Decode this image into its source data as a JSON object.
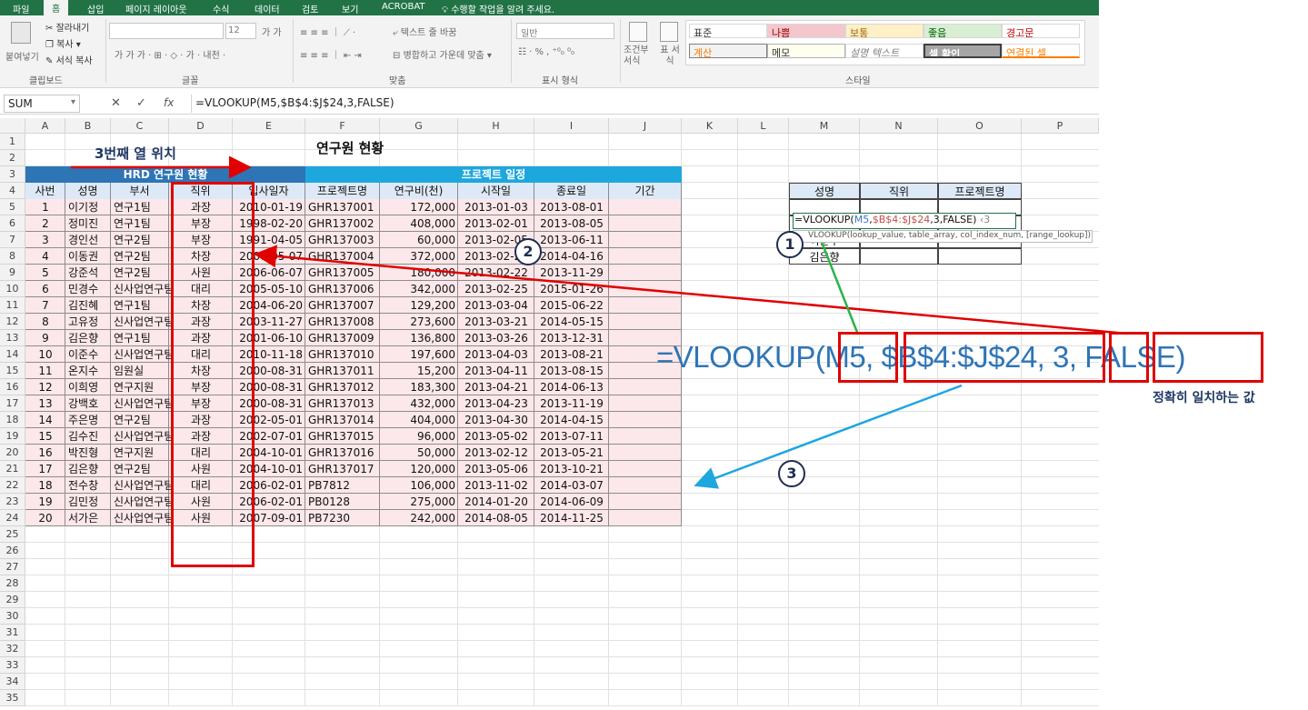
{
  "ribbon_tabs": [
    "파일",
    "홈",
    "삽입",
    "페이지 레이아웃",
    "수식",
    "데이터",
    "검토",
    "보기",
    "ACROBAT"
  ],
  "tell_me": "수행할 작업을 알려 주세요.",
  "clipboard": {
    "paste": "붙여넣기",
    "cut": "잘라내기",
    "copy": "복사",
    "format_painter": "서식 복사",
    "group": "클립보드"
  },
  "font": {
    "size": "12",
    "group": "글꼴"
  },
  "align": {
    "wrap": "텍스트 줄 바꿈",
    "merge": "병합하고 가운데 맞춤",
    "group": "맞춤"
  },
  "number": {
    "format": "일반",
    "group": "표시 형식"
  },
  "cond": {
    "cond_format": "조건부 서식",
    "table_format": "표 서식"
  },
  "styles": {
    "items": [
      "표준",
      "나쁨",
      "보통",
      "좋음",
      "경고문",
      "계산",
      "메모",
      "설명 텍스트",
      "셀 확인",
      "연결된 셀"
    ],
    "group": "스타일"
  },
  "formula_bar": {
    "name_box": "SUM",
    "formula": "=VLOOKUP(M5,$B$4:$J$24,3,FALSE)"
  },
  "columns": [
    "A",
    "B",
    "C",
    "D",
    "E",
    "F",
    "G",
    "H",
    "I",
    "J",
    "K",
    "L",
    "M",
    "N",
    "O",
    "P"
  ],
  "sheet": {
    "title": "연구원 현황",
    "annotation_col3": "3번째 열 위치",
    "header_left": "HRD 연구원 현황",
    "header_right": "프로젝트 일정",
    "col_headers": [
      "사번",
      "성명",
      "부서",
      "직위",
      "입사일자",
      "프로젝트명",
      "연구비(천)",
      "시작일",
      "종료일",
      "기간"
    ],
    "rows": [
      [
        "1",
        "이기정",
        "연구1팀",
        "과장",
        "2010-01-19",
        "GHR137001",
        "172,000",
        "2013-01-03",
        "2013-08-01"
      ],
      [
        "2",
        "정미진",
        "연구1팀",
        "부장",
        "1998-02-20",
        "GHR137002",
        "408,000",
        "2013-02-01",
        "2013-08-05"
      ],
      [
        "3",
        "경인선",
        "연구2팀",
        "부장",
        "1991-04-05",
        "GHR137003",
        "60,000",
        "2013-02-05",
        "2013-06-11"
      ],
      [
        "4",
        "이동권",
        "연구2팀",
        "차장",
        "2000-05-07",
        "GHR137004",
        "372,000",
        "2013-02-20",
        "2014-04-16"
      ],
      [
        "5",
        "강준석",
        "연구2팀",
        "사원",
        "2006-06-07",
        "GHR137005",
        "180,000",
        "2013-02-22",
        "2013-11-29"
      ],
      [
        "6",
        "민경수",
        "신사업연구팀",
        "대리",
        "2005-05-10",
        "GHR137006",
        "342,000",
        "2013-02-25",
        "2015-01-26"
      ],
      [
        "7",
        "김진혜",
        "연구1팀",
        "차장",
        "2004-06-20",
        "GHR137007",
        "129,200",
        "2013-03-04",
        "2015-06-22"
      ],
      [
        "8",
        "고유정",
        "신사업연구팀",
        "과장",
        "2003-11-27",
        "GHR137008",
        "273,600",
        "2013-03-21",
        "2014-05-15"
      ],
      [
        "9",
        "김은향",
        "연구1팀",
        "과장",
        "2001-06-10",
        "GHR137009",
        "136,800",
        "2013-03-26",
        "2013-12-31"
      ],
      [
        "10",
        "이준수",
        "신사업연구팀",
        "대리",
        "2010-11-18",
        "GHR137010",
        "197,600",
        "2013-04-03",
        "2013-08-21"
      ],
      [
        "11",
        "온지수",
        "임원실",
        "차장",
        "2000-08-31",
        "GHR137011",
        "15,200",
        "2013-04-11",
        "2013-08-15"
      ],
      [
        "12",
        "이희영",
        "연구지원",
        "부장",
        "2000-08-31",
        "GHR137012",
        "183,300",
        "2013-04-21",
        "2014-06-13"
      ],
      [
        "13",
        "강백호",
        "신사업연구팀",
        "부장",
        "2000-08-31",
        "GHR137013",
        "432,000",
        "2013-04-23",
        "2013-11-19"
      ],
      [
        "14",
        "주은명",
        "연구2팀",
        "과장",
        "2002-05-01",
        "GHR137014",
        "404,000",
        "2013-04-30",
        "2014-04-15"
      ],
      [
        "15",
        "김수진",
        "신사업연구팀",
        "과장",
        "2002-07-01",
        "GHR137015",
        "96,000",
        "2013-05-02",
        "2013-07-11"
      ],
      [
        "16",
        "박진형",
        "연구지원",
        "대리",
        "2004-10-01",
        "GHR137016",
        "50,000",
        "2013-02-12",
        "2013-05-21"
      ],
      [
        "17",
        "김은향",
        "연구2팀",
        "사원",
        "2004-10-01",
        "GHR137017",
        "120,000",
        "2013-05-06",
        "2013-10-21"
      ],
      [
        "18",
        "전수창",
        "신사업연구팀",
        "대리",
        "2006-02-01",
        "PB7812",
        "106,000",
        "2013-11-02",
        "2014-03-07"
      ],
      [
        "19",
        "김민정",
        "신사업연구팀",
        "사원",
        "2006-02-01",
        "PB0128",
        "275,000",
        "2014-01-20",
        "2014-06-09"
      ],
      [
        "20",
        "서가은",
        "신사업연구팀",
        "사원",
        "2007-09-01",
        "PB7230",
        "242,000",
        "2014-08-05",
        "2014-11-25"
      ]
    ],
    "lookup": {
      "headers": [
        "성명",
        "직위",
        "프로젝트명"
      ],
      "names": [
        "",
        "",
        "이준수",
        "김은향"
      ],
      "edit_formula": "=VLOOKUP(M5,$B$4:$J$24,3,FALSE)",
      "tooltip": "VLOOKUP(lookup_value, table_array, col_index_num, [range_lookup])"
    }
  },
  "overlay": {
    "big_formula_prefix": "=VLOOKUP(",
    "arg1": "M5",
    "arg2": "$B$4:$J$24",
    "arg3": "3",
    "arg4": "FALSE",
    "close": ")",
    "exact_match_note": "정확히 일치하는 값",
    "markers": [
      "1",
      "2",
      "3"
    ]
  }
}
